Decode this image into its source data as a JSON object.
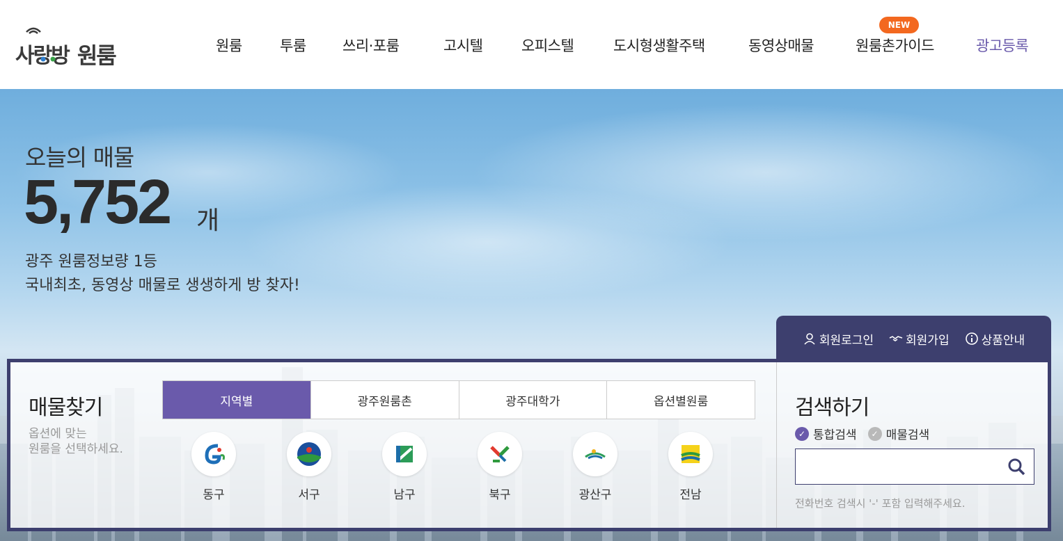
{
  "logo": {
    "text": "사랑방",
    "word": "원룸"
  },
  "nav": {
    "items": [
      "원룸",
      "투룸",
      "쓰리·포룸",
      "고시텔",
      "오피스텔",
      "도시형생활주택",
      "동영상매물",
      "원룸촌가이드",
      "광고등록"
    ],
    "new_badge": "NEW"
  },
  "hero": {
    "subtitle": "오늘의 매물",
    "count": "5,752",
    "unit": "개",
    "line1": "광주 원룸정보량 1등",
    "line2": "국내최초, 동영상 매물로 생생하게 방 찾자!"
  },
  "member": {
    "login": "회원로그인",
    "join": "회원가입",
    "info": "상품안내"
  },
  "find": {
    "title": "매물찾기",
    "desc_line1": "옵션에 맞는",
    "desc_line2": "원룸을 선택하세요.",
    "tabs": [
      "지역별",
      "광주원룸촌",
      "광주대학가",
      "옵션별원룸"
    ],
    "regions": [
      "동구",
      "서구",
      "남구",
      "북구",
      "광산구",
      "전남"
    ]
  },
  "search": {
    "title": "검색하기",
    "option_all": "통합검색",
    "option_listing": "매물검색",
    "input_value": "",
    "hint": "전화번호 검색시 '-' 포함 입력해주세요."
  },
  "colors": {
    "accent": "#6a5aab",
    "navy": "#3d3f6e",
    "badge": "#f3681f"
  }
}
